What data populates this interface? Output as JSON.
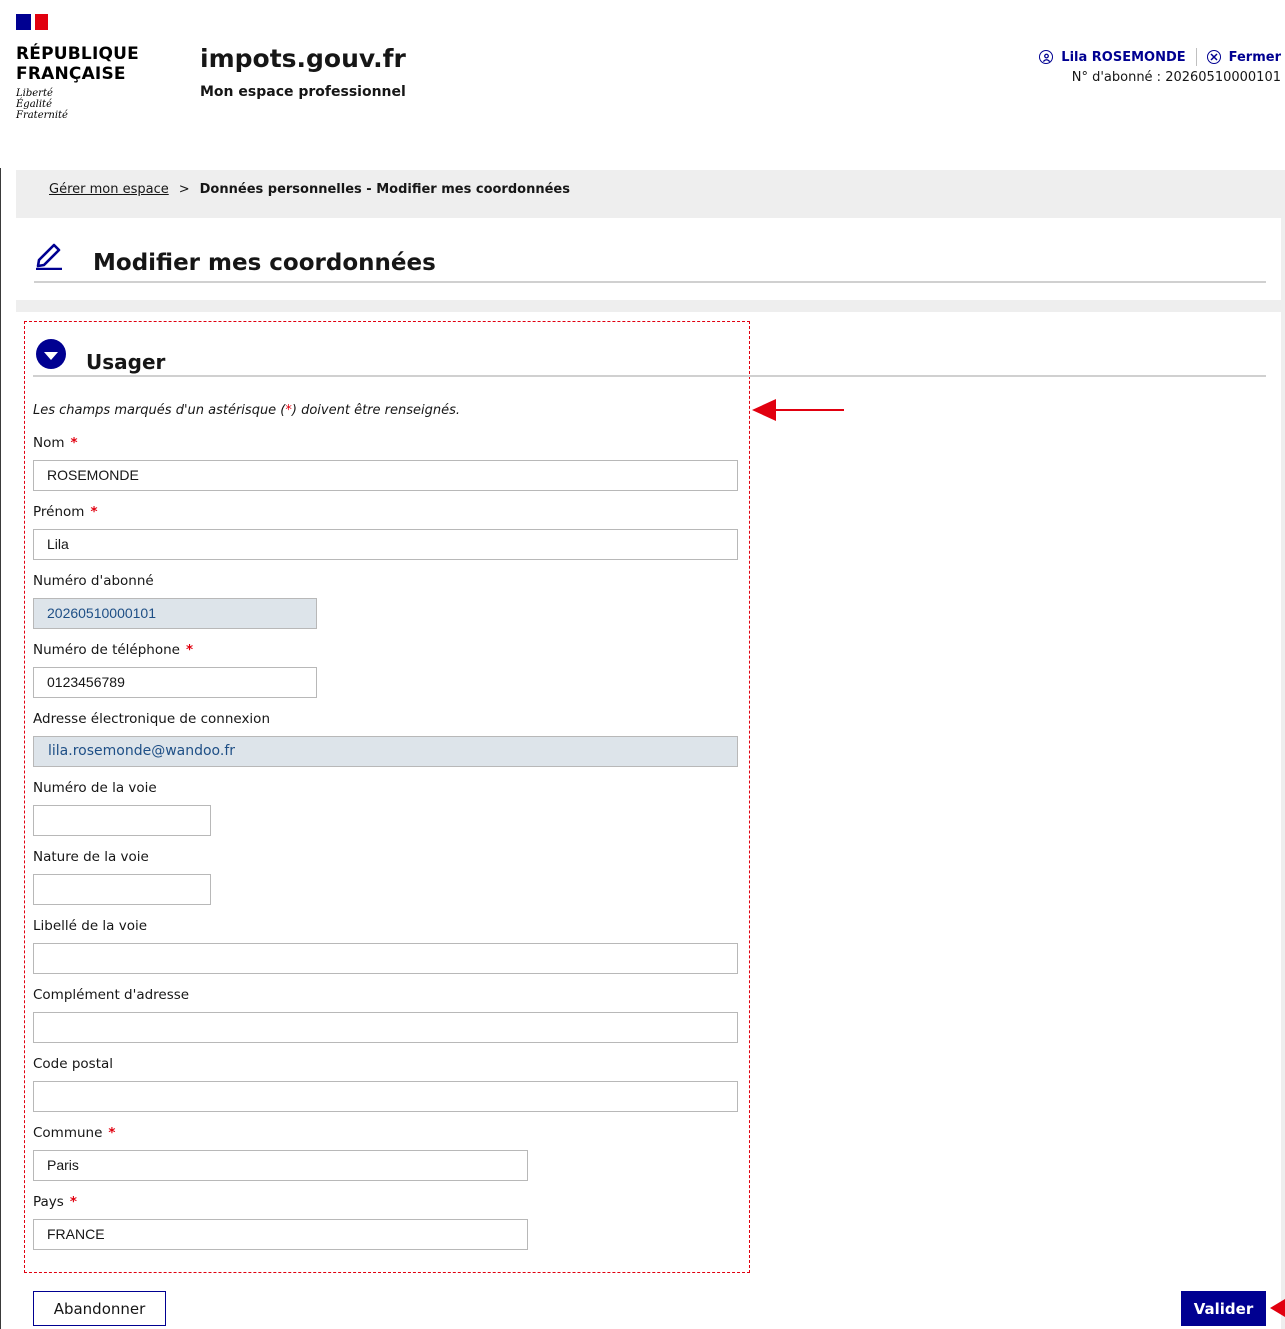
{
  "header": {
    "republic_title_line1": "RÉPUBLIQUE",
    "republic_title_line2": "FRANÇAISE",
    "motto_line1": "Liberté",
    "motto_line2": "Égalité",
    "motto_line3": "Fraternité",
    "site_name": "impots.gouv.fr",
    "site_subtitle": "Mon espace professionnel",
    "user_name": "Lila ROSEMONDE",
    "close_label": "Fermer",
    "subscriber_text": "N° d'abonné : 20260510000101"
  },
  "breadcrumb": {
    "parent": "Gérer mon espace",
    "separator": ">",
    "current": "Données personnelles - Modifier mes coordonnées"
  },
  "page": {
    "title": "Modifier mes coordonnées"
  },
  "section": {
    "title": "Usager",
    "hint_before": "Les champs marqués d'un astérisque (",
    "hint_star": "*",
    "hint_after": ") doivent être renseignés."
  },
  "form": {
    "required_mark": "*",
    "nom": {
      "label": "Nom",
      "value": "ROSEMONDE"
    },
    "prenom": {
      "label": "Prénom",
      "value": "Lila"
    },
    "numero_abonne": {
      "label": "Numéro d'abonné",
      "value": "20260510000101"
    },
    "telephone": {
      "label": "Numéro de téléphone",
      "value": "0123456789"
    },
    "email": {
      "label": "Adresse électronique de connexion",
      "value": "lila.rosemonde@wandoo.fr"
    },
    "numero_voie": {
      "label": "Numéro de la voie",
      "value": ""
    },
    "nature_voie": {
      "label": "Nature de la voie",
      "value": ""
    },
    "libelle_voie": {
      "label": "Libellé de la voie",
      "value": ""
    },
    "complement": {
      "label": "Complément d'adresse",
      "value": ""
    },
    "code_postal": {
      "label": "Code postal",
      "value": ""
    },
    "commune": {
      "label": "Commune",
      "value": "Paris"
    },
    "pays": {
      "label": "Pays",
      "value": "FRANCE"
    }
  },
  "actions": {
    "abandon_label": "Abandonner",
    "submit_label": "Valider"
  },
  "colors": {
    "primary": "#000091",
    "required": "#e1000f",
    "annotation": "#e1000f",
    "readonly_bg": "#dde4ea"
  }
}
